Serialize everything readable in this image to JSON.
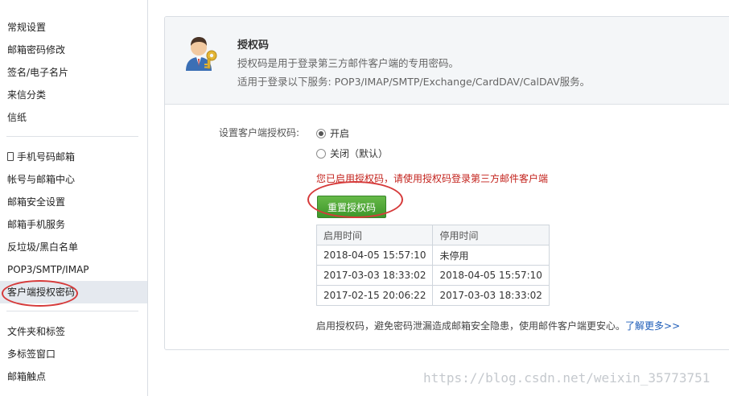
{
  "sidebar": {
    "items": [
      "常规设置",
      "邮箱密码修改",
      "签名/电子名片",
      "来信分类",
      "信纸",
      "手机号码邮箱",
      "帐号与邮箱中心",
      "邮箱安全设置",
      "邮箱手机服务",
      "反垃圾/黑白名单",
      "POP3/SMTP/IMAP",
      "客户端授权密码",
      "文件夹和标签",
      "多标签窗口",
      "邮箱触点"
    ],
    "active_index": 11
  },
  "header": {
    "title": "授权码",
    "desc": "授权码是用于登录第三方邮件客户端的专用密码。",
    "services": "适用于登录以下服务: POP3/IMAP/SMTP/Exchange/CardDAV/CalDAV服务。"
  },
  "form": {
    "label": "设置客户端授权码:",
    "options": [
      "开启",
      "关闭（默认）"
    ],
    "selected": "开启",
    "warning": "您已启用授权码，请使用授权码登录第三方邮件客户端",
    "reset_button": "重置授权码"
  },
  "table": {
    "headers": [
      "启用时间",
      "停用时间"
    ],
    "rows": [
      [
        "2018-04-05 15:57:10",
        "未停用"
      ],
      [
        "2017-03-03 18:33:02",
        "2018-04-05 15:57:10"
      ],
      [
        "2017-02-15 20:06:22",
        "2017-03-03 18:33:02"
      ]
    ]
  },
  "footer": {
    "text": "启用授权码，避免密码泄漏造成邮箱安全隐患，使用邮件客户端更安心。",
    "link": "了解更多>>"
  },
  "watermark": "https://blog.csdn.net/weixin_35773751",
  "colors": {
    "accent_green": "#4aa535",
    "warning_red": "#c3221c",
    "link_blue": "#1d5cb8",
    "annotation_red": "#d63a3a"
  }
}
